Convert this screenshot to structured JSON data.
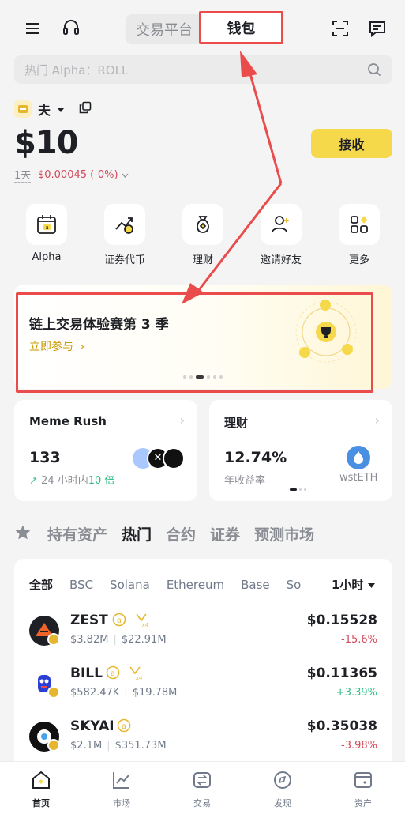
{
  "header": {
    "tabs": [
      {
        "label": "交易平台",
        "active": false
      },
      {
        "label": "钱包",
        "active": true
      }
    ]
  },
  "search": {
    "placeholder": "热门 Alpha：ROLL"
  },
  "account": {
    "name": "夫",
    "balance": "$10",
    "period": "1天",
    "pnl": "-$0.00045 (-0%)",
    "receive_label": "接收"
  },
  "quick_actions": [
    {
      "label": "Alpha",
      "icon": "alpha-calendar-icon"
    },
    {
      "label": "证券代币",
      "icon": "stock-token-icon"
    },
    {
      "label": "理财",
      "icon": "earn-bag-icon"
    },
    {
      "label": "邀请好友",
      "icon": "invite-user-icon"
    },
    {
      "label": "更多",
      "icon": "more-grid-icon"
    }
  ],
  "banner": {
    "title": "链上交易体验赛第 3 季",
    "link": "立即参与",
    "slides": 6,
    "active_slide": 2
  },
  "cards": {
    "meme": {
      "title": "Meme Rush",
      "value": "133",
      "sub_prefix": "24 小时内",
      "sub_highlight": "10 倍"
    },
    "earn": {
      "title": "理财",
      "value": "12.74%",
      "sub": "年收益率",
      "asset": "wstETH"
    }
  },
  "section_tabs": [
    {
      "label": "持有资产",
      "active": false
    },
    {
      "label": "热门",
      "active": true
    },
    {
      "label": "合约",
      "active": false
    },
    {
      "label": "证券",
      "active": false
    },
    {
      "label": "预测市场",
      "active": false
    }
  ],
  "chains": [
    {
      "label": "全部",
      "active": true
    },
    {
      "label": "BSC",
      "active": false
    },
    {
      "label": "Solana",
      "active": false
    },
    {
      "label": "Ethereum",
      "active": false
    },
    {
      "label": "Base",
      "active": false
    },
    {
      "label": "So",
      "active": false
    }
  ],
  "time_filter": "1小时",
  "tokens": [
    {
      "symbol": "ZEST",
      "mcap": "$3.82M",
      "volume": "$22.91M",
      "price": "$0.15528",
      "change": "-15.6%",
      "dir": "down",
      "avatar_color": "#f0642a",
      "x4": true
    },
    {
      "symbol": "BILL",
      "mcap": "$582.47K",
      "volume": "$19.78M",
      "price": "$0.11365",
      "change": "+3.39%",
      "dir": "up",
      "avatar_color": "#2a3fd6",
      "x4": true
    },
    {
      "symbol": "SKYAI",
      "mcap": "$2.1M",
      "volume": "$351.73M",
      "price": "$0.35038",
      "change": "-3.98%",
      "dir": "down",
      "avatar_color": "#111111",
      "x4": false
    }
  ],
  "bottom_nav": [
    {
      "label": "首页",
      "icon": "home-icon",
      "active": true
    },
    {
      "label": "市场",
      "icon": "market-chart-icon",
      "active": false
    },
    {
      "label": "交易",
      "icon": "trade-swap-icon",
      "active": false
    },
    {
      "label": "发现",
      "icon": "discover-compass-icon",
      "active": false
    },
    {
      "label": "资产",
      "icon": "assets-wallet-icon",
      "active": false
    }
  ],
  "colors": {
    "accent": "#f5d94a",
    "down": "#d1495b",
    "up": "#2ebd85",
    "annotation": "#ea4b4b"
  }
}
